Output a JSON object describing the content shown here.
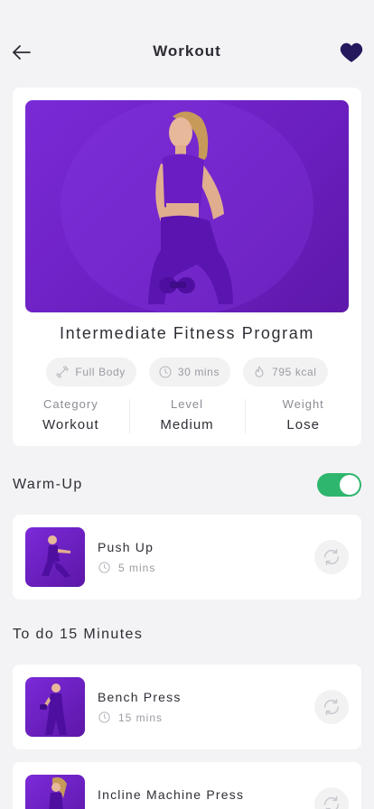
{
  "header": {
    "title": "Workout"
  },
  "program": {
    "title": "Intermediate Fitness Program",
    "chips": {
      "body": "Full Body",
      "duration": "30 mins",
      "calories": "795 kcal"
    },
    "stats": {
      "category_label": "Category",
      "category_value": "Workout",
      "level_label": "Level",
      "level_value": "Medium",
      "weight_label": "Weight",
      "weight_value": "Lose"
    }
  },
  "warmup": {
    "title": "Warm-Up",
    "toggle_on": true,
    "items": [
      {
        "name": "Push Up",
        "duration": "5 mins"
      }
    ]
  },
  "todo": {
    "title": "To do 15 Minutes",
    "items": [
      {
        "name": "Bench Press",
        "duration": "15 mins"
      },
      {
        "name": "Incline Machine Press",
        "duration": ""
      }
    ]
  },
  "colors": {
    "accent_purple": "#6a1fbf",
    "toggle_green": "#2fb66e",
    "heart": "#26185c"
  }
}
